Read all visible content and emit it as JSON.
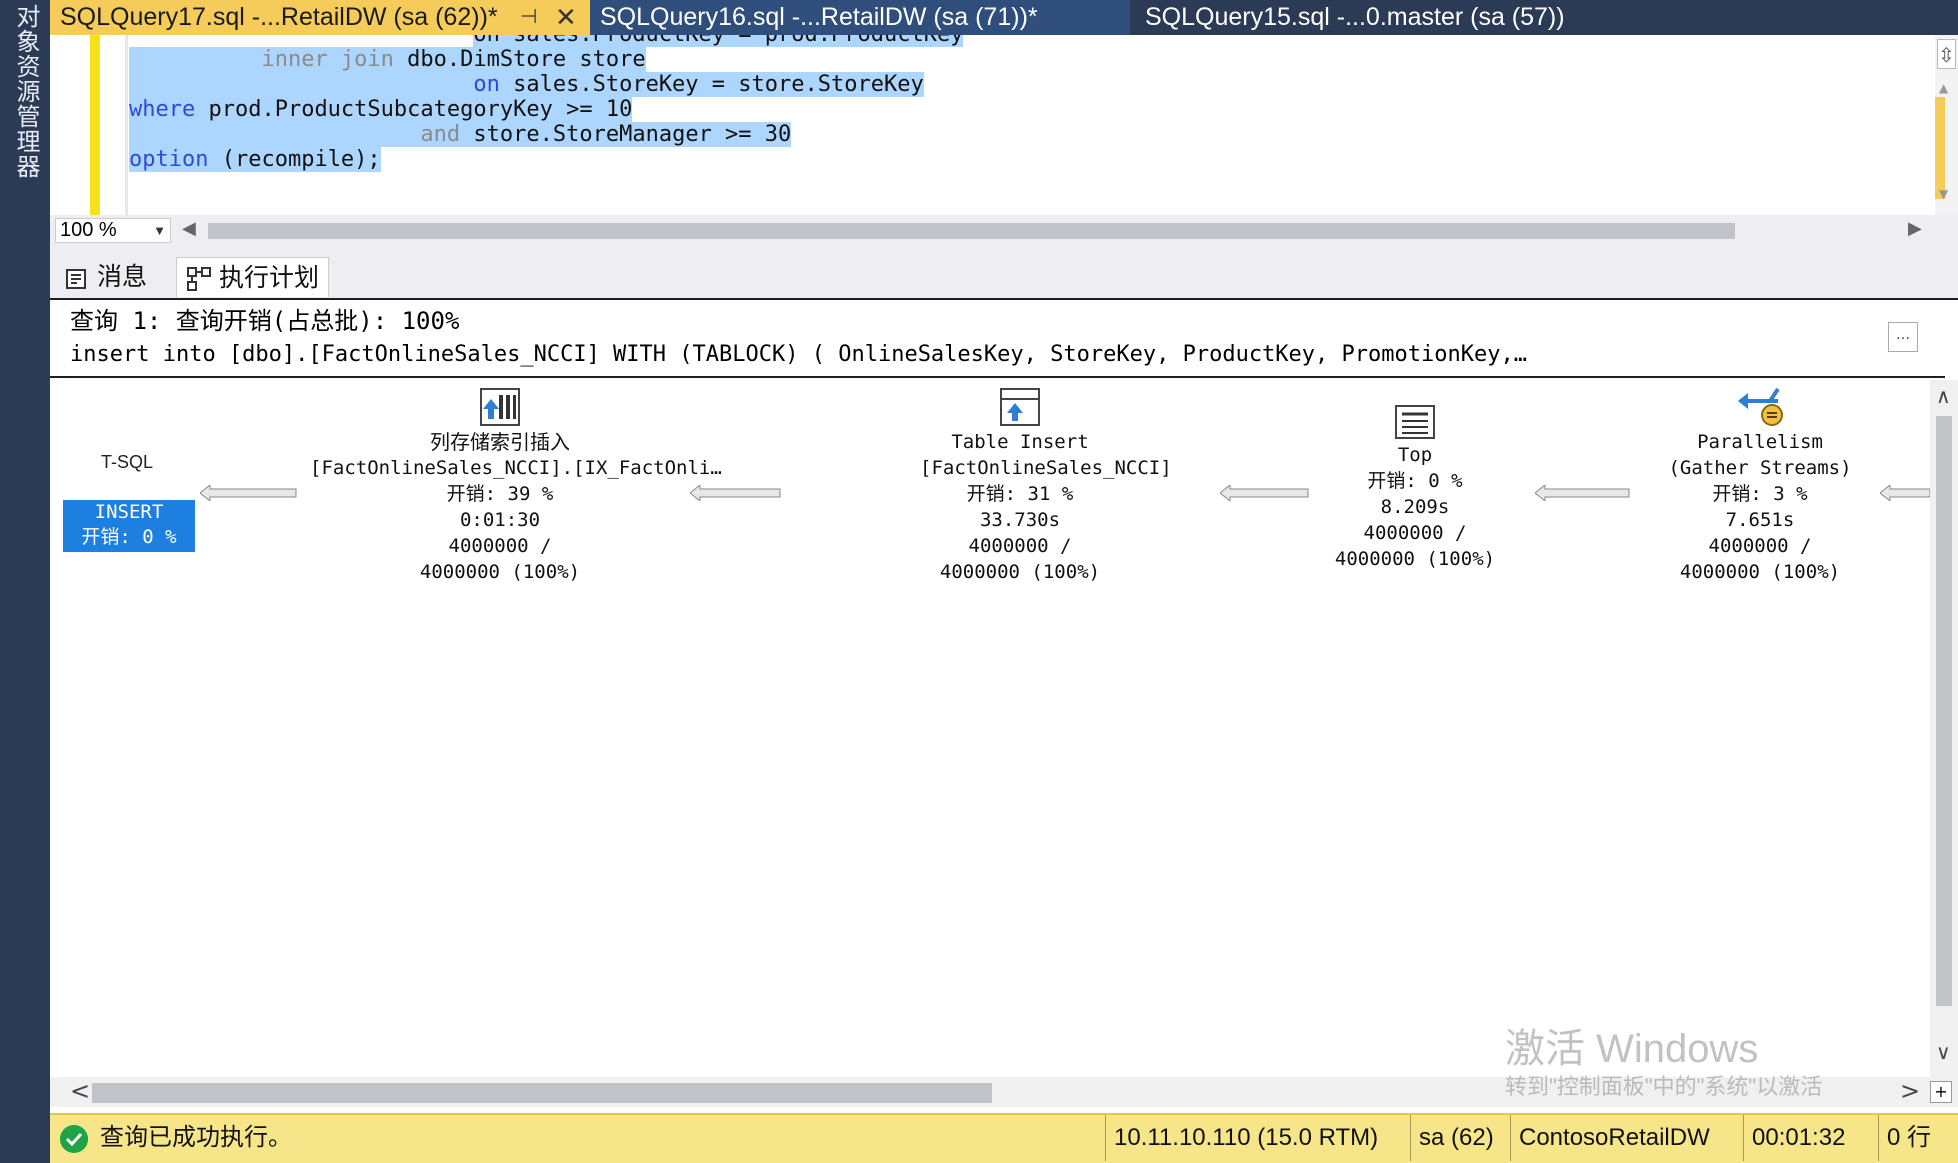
{
  "sidebar": {
    "label": "对象资源管理器"
  },
  "tabs": [
    {
      "label": "SQLQuery17.sql -...RetailDW (sa (62))*"
    },
    {
      "label": "SQLQuery16.sql -...RetailDW (sa (71))*"
    },
    {
      "label": "SQLQuery15.sql -...0.master (sa (57))"
    }
  ],
  "editor": {
    "lines": [
      {
        "indent": "                          ",
        "text": "on sales.ProductKey = prod.ProductKey"
      },
      {
        "indent": "          ",
        "kw": "inner join",
        "rest": " dbo.DimStore store"
      },
      {
        "indent": "                          ",
        "kw": "on",
        "rest": " sales.StoreKey = store.StoreKey"
      },
      {
        "indent": "",
        "kw": "where",
        "rest": " prod.ProductSubcategoryKey >= 10"
      },
      {
        "indent": "                      ",
        "kw": "and",
        "rest": " store.StoreManager >= 30"
      },
      {
        "indent": "",
        "kw": "option",
        "rest": " (recompile);"
      }
    ]
  },
  "zoom": {
    "value": "100 %"
  },
  "results": {
    "messages_tab": "消息",
    "plan_tab": "执行计划",
    "plan_title": "查询 1: 查询开销(占总批): 100%",
    "plan_sql": "insert into [dbo].[FactOnlineSales_NCCI] WITH (TABLOCK) ( OnlineSalesKey, StoreKey, ProductKey, PromotionKey,…"
  },
  "plan": {
    "tsql_label": "T-SQL",
    "insert_node": {
      "name": "INSERT",
      "cost": "开销: 0 %"
    },
    "nodes": [
      {
        "name": "列存储索引插入",
        "object": "[FactOnlineSales_NCCI].[IX_FactOnli…",
        "cost": "开销: 39 %",
        "time": "0:01:30",
        "rows1": "4000000 /",
        "rows2": "4000000 (100%)"
      },
      {
        "name": "Table Insert",
        "object": "[FactOnlineSales_NCCI]",
        "cost": "开销: 31 %",
        "time": "33.730s",
        "rows1": "4000000 /",
        "rows2": "4000000 (100%)"
      },
      {
        "name": "Top",
        "object": "",
        "cost": "开销: 0 %",
        "time": "8.209s",
        "rows1": "4000000 /",
        "rows2": "4000000 (100%)"
      },
      {
        "name": "Parallelism",
        "object": "(Gather Streams)",
        "cost": "开销: 3 %",
        "time": "7.651s",
        "rows1": "4000000 /",
        "rows2": "4000000 (100%)"
      }
    ]
  },
  "status": {
    "message": "查询已成功执行。",
    "server": "10.11.10.110 (15.0 RTM)",
    "user": "sa (62)",
    "database": "ContosoRetailDW",
    "elapsed": "00:01:32",
    "rows": "0 行"
  },
  "watermark": {
    "title": "激活 Windows",
    "subtitle": "转到\"控制面板\"中的\"系统\"以激活"
  },
  "colors": {
    "active_tab": "#f5cc5a",
    "selection": "#add6ff",
    "keyword": "#2c49d8",
    "selected_node": "#1d7fe0",
    "statusbar": "#f7e58a"
  }
}
